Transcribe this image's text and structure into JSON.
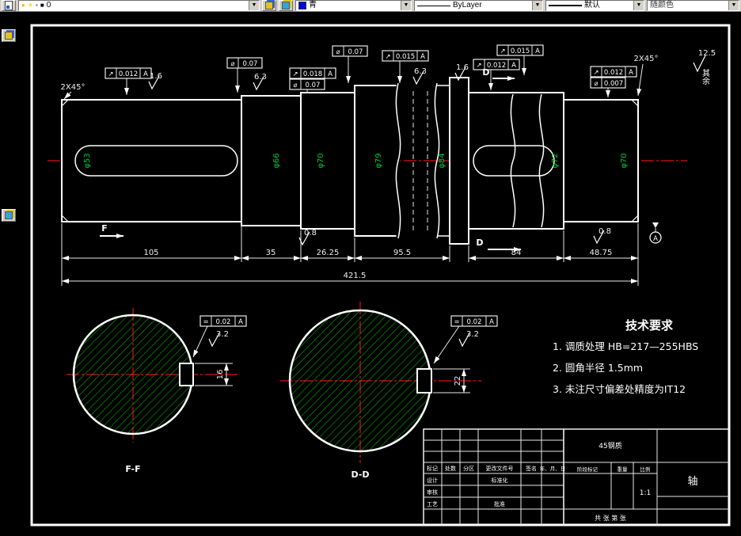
{
  "toolbar": {
    "layer_name": "0",
    "color_label": "青",
    "color_swatch": "#0008d8",
    "linetype_label": "ByLayer",
    "lineweight_label": "默认",
    "plotstyle_label": "随颜色"
  },
  "colors": {
    "hatch": "#00bb00",
    "centerline": "#dd1111",
    "dimension": "#eeeeee",
    "diameter_text": "#00cc33"
  },
  "dims": {
    "s1": "105",
    "s2": "35",
    "s3": "26.25",
    "s4": "95.5",
    "s5": "84",
    "s6": "48.75",
    "total": "421.5",
    "key_f": "16",
    "key_d": "22"
  },
  "dia": {
    "d1": "φ53",
    "d2": "φ66",
    "d3": "φ70",
    "d4": "φ79",
    "d5": "φ84",
    "d6": "φ72",
    "d7": "φ70"
  },
  "fcf": {
    "a": {
      "sym": "↗",
      "val": "0.012",
      "dat": "A"
    },
    "b": {
      "sym": "⌀",
      "val": "0.07"
    },
    "c": {
      "sym": "↗",
      "val": "0.018",
      "dat": "A"
    },
    "d": {
      "sym": "⌀",
      "val": "0.07"
    },
    "e": {
      "sym": "⌀",
      "val": "0.07"
    },
    "f": {
      "sym": "↗",
      "val": "0.015",
      "dat": "A"
    },
    "g": {
      "sym": "↗",
      "val": "0.012",
      "dat": "A"
    },
    "h": {
      "sym": "↗",
      "val": "0.015",
      "dat": "A"
    },
    "i": {
      "sym": "↗",
      "val": "0.012",
      "dat": "A"
    },
    "j": {
      "sym": "⌀",
      "val": "0.007"
    },
    "k": {
      "sym": "=",
      "val": "0.02",
      "dat": "A"
    },
    "l": {
      "sym": "=",
      "val": "0.02",
      "dat": "A"
    }
  },
  "rough": {
    "r1": "1.6",
    "r2": "6.3",
    "r3": "6.3",
    "r4": "1.6",
    "r5": "0.8",
    "r6": "0.8",
    "r7": "3.2",
    "r8": "3.2",
    "default": "12.5"
  },
  "ann": {
    "surplus": "其余",
    "chamfer_left": "2X45°",
    "chamfer_right": "2X45°",
    "datum": "A",
    "cut_f": "F",
    "cut_d": "D",
    "view_f": "F-F",
    "view_d": "D-D"
  },
  "tech": {
    "title": "技术要求",
    "line1": "1. 调质处理 HB=217—255HBS",
    "line2": "2. 圆角半径 1.5mm",
    "line3": "3. 未注尺寸偏差处精度为IT12"
  },
  "tb": {
    "h1": "标记",
    "h2": "处数",
    "h3": "分区",
    "h4": "更改文件号",
    "h5": "签名",
    "h6": "年、月、日",
    "r1": "设计",
    "r2": "标准化",
    "r3": "审核",
    "r4": "工艺",
    "r5": "批准",
    "stage": "阶段标记",
    "weight": "重量",
    "scale_label": "比例",
    "scale": "1:1",
    "material": "45钢质",
    "part": "轴",
    "sheet": "共 张 第 张"
  }
}
